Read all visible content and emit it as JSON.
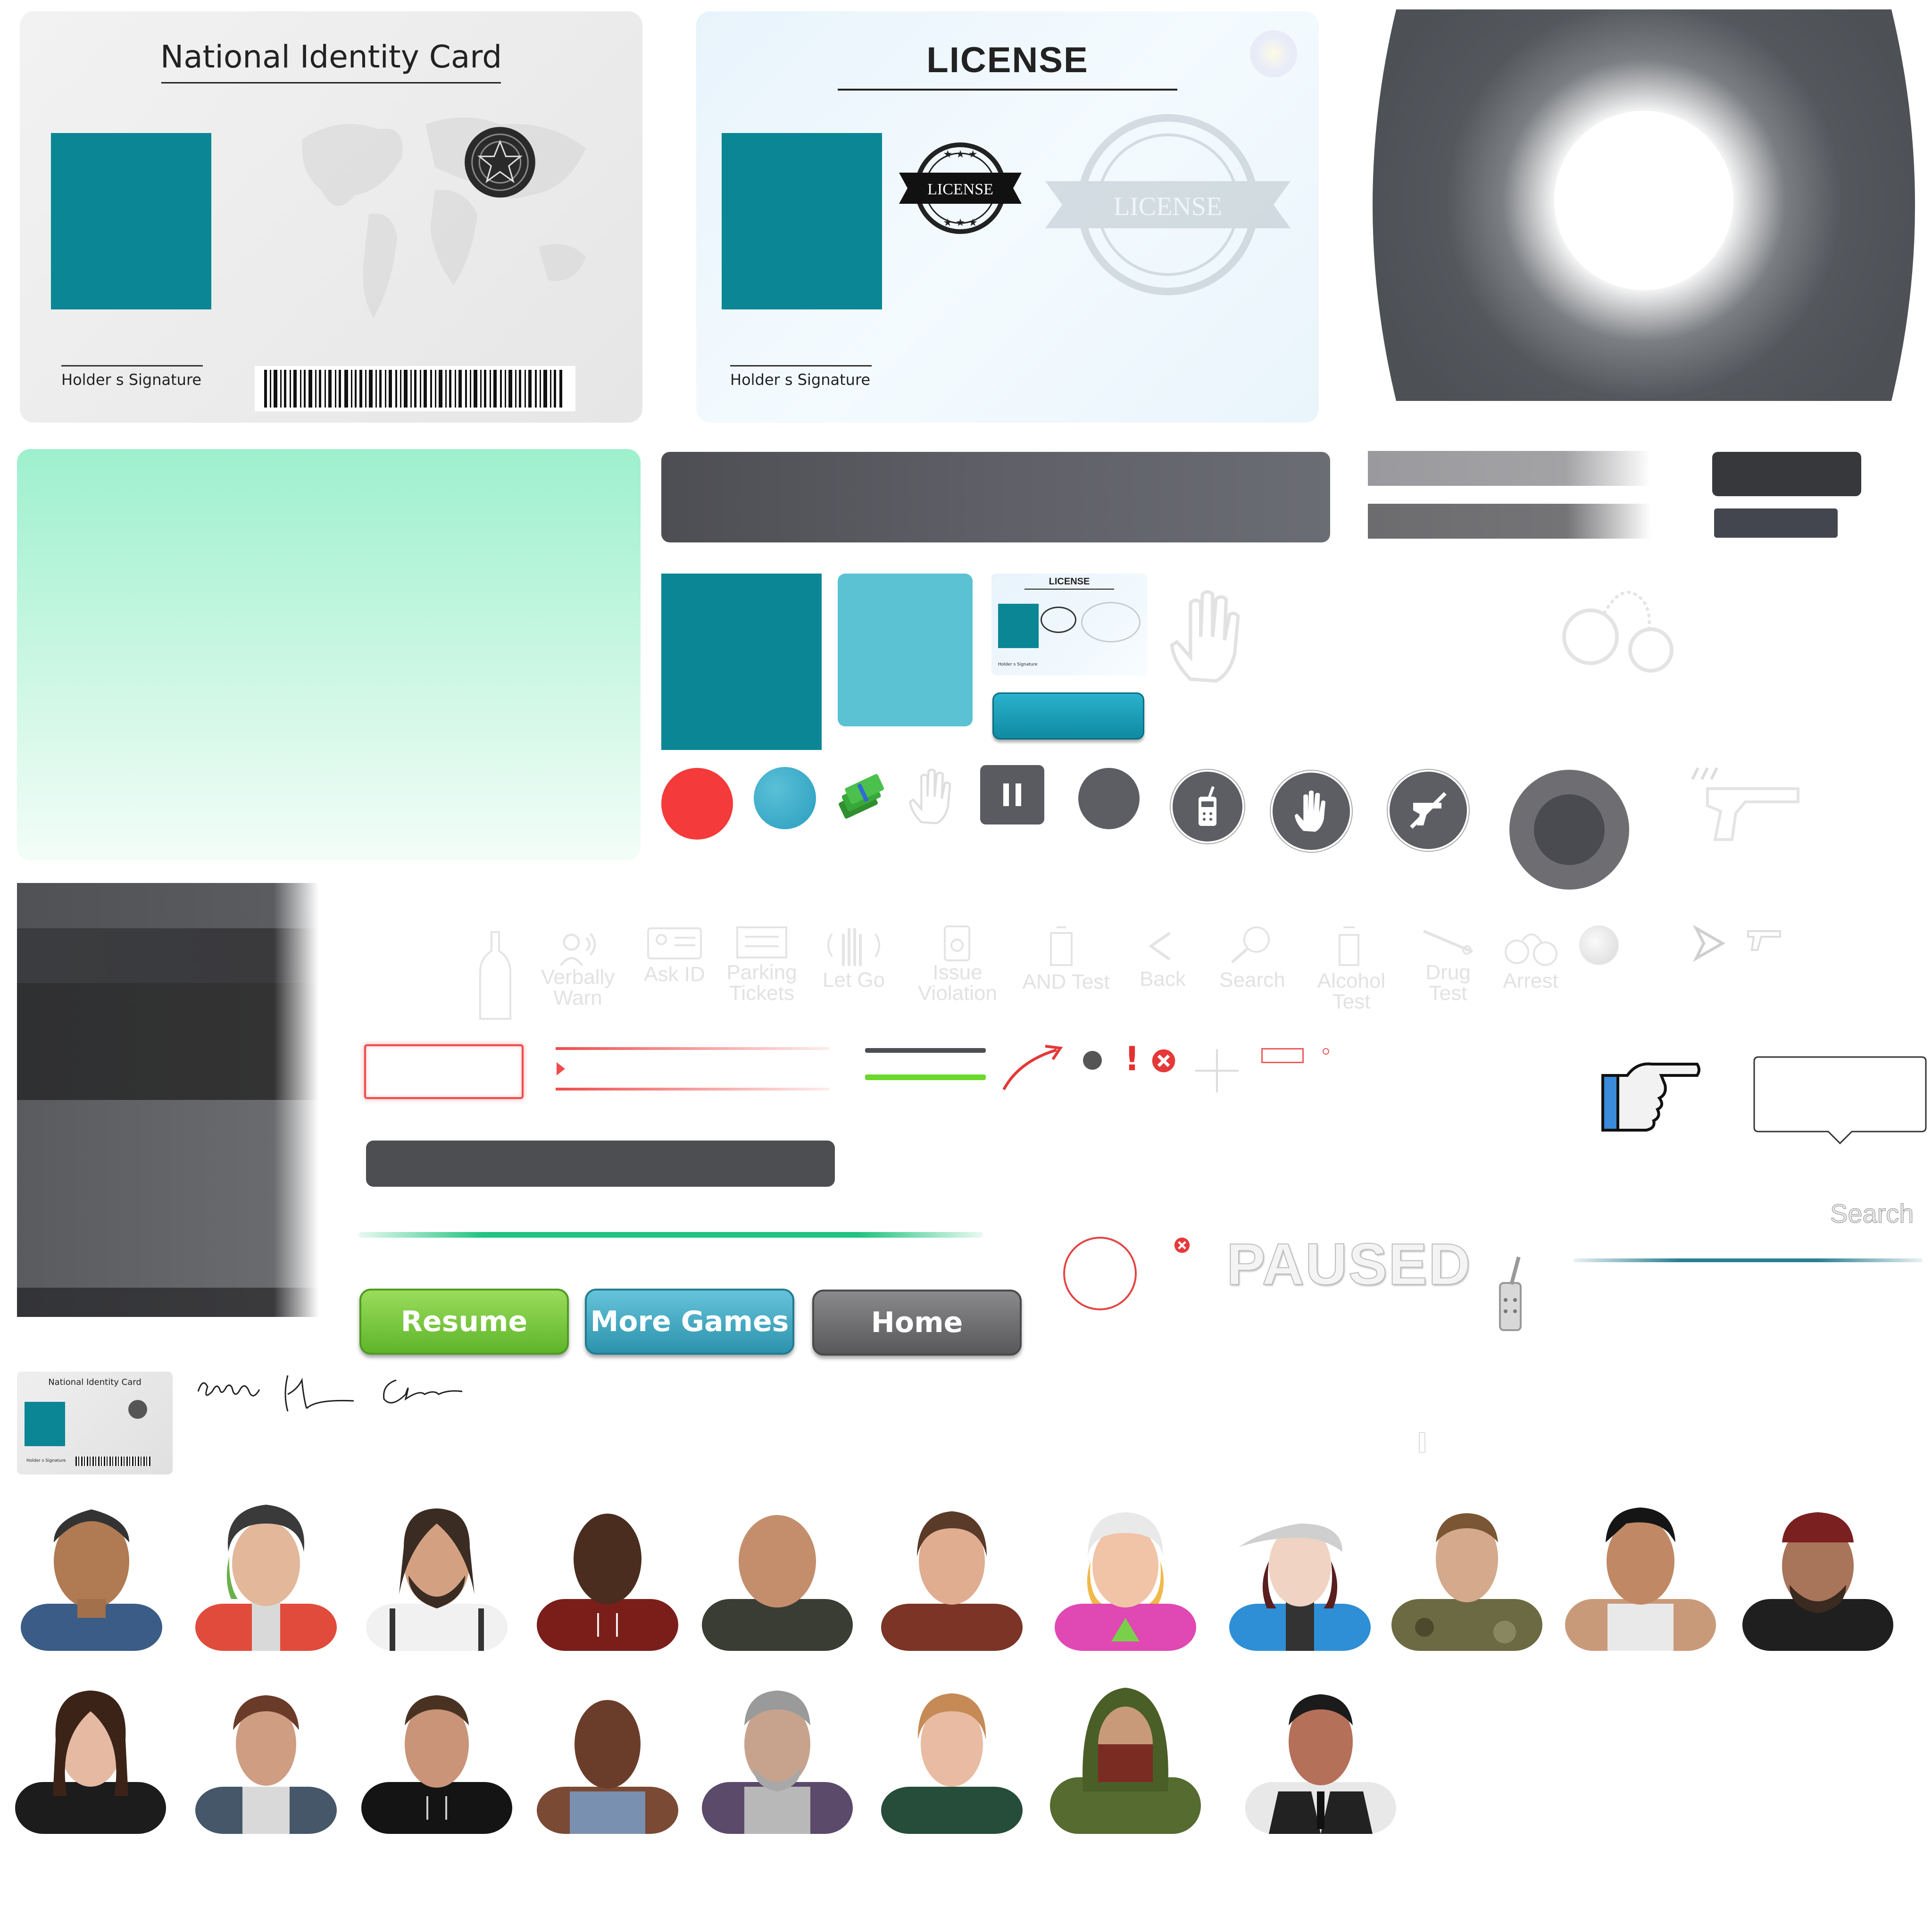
{
  "id_card": {
    "title": "National Identity Card",
    "signature_label": "Holder s Signature"
  },
  "license_card": {
    "title": "LICENSE",
    "stamp_text": "LICENSE",
    "watermark_text": "LICENSE",
    "signature_label": "Holder s Signature"
  },
  "mini_license": {
    "title": "LICENSE",
    "signature_label": "Holder s Signature"
  },
  "mini_id_card": {
    "title": "National Identity Card",
    "signature_label": "Holder s Signature"
  },
  "action_labels": [
    {
      "icon": "bottle-icon",
      "label": ""
    },
    {
      "icon": "speak-icon",
      "label": "Verbally Warn"
    },
    {
      "icon": "id-card-icon",
      "label": "Ask ID"
    },
    {
      "icon": "ticket-icon",
      "label": "Parking Tickets"
    },
    {
      "icon": "hand-icon",
      "label": "Let Go"
    },
    {
      "icon": "violation-icon",
      "label": "Issue Violation"
    },
    {
      "icon": "and-test-icon",
      "label": "AND Test"
    },
    {
      "icon": "back-icon",
      "label": "Back"
    },
    {
      "icon": "search-icon",
      "label": "Search"
    },
    {
      "icon": "alcohol-test-icon",
      "label": "Alcohol Test"
    },
    {
      "icon": "drug-test-icon",
      "label": "Drug Test"
    },
    {
      "icon": "handcuffs-icon",
      "label": "Arrest"
    }
  ],
  "buttons": {
    "resume": "Resume",
    "more_games": "More Games",
    "home": "Home"
  },
  "paused_text": "PAUSED",
  "search_label": "Search",
  "colors": {
    "teal": "#0b8695",
    "light_teal": "#5bc2d4",
    "mint": "#9ef0cd",
    "red": "#f43a3a",
    "dark_gray": "#5a5b61",
    "green_button": "#75c93c",
    "blue_button": "#3ea6c0",
    "gray_button": "#6d6d70"
  },
  "portraits_row1": [
    "portrait-young-man",
    "portrait-woman-beanie",
    "portrait-bearded-man",
    "portrait-man-red-hoodie",
    "portrait-bald-man",
    "portrait-woman-brown-top",
    "portrait-girl-white-cap",
    "portrait-woman-cap-blue-jacket",
    "portrait-man-camo-jacket",
    "portrait-man-tank-top",
    "portrait-man-bandana"
  ],
  "portraits_row2": [
    "portrait-woman-leather-jacket",
    "portrait-woman-short-hair",
    "portrait-man-black-hoodie",
    "portrait-woman-blue-tank",
    "portrait-old-man",
    "portrait-woman-green-top",
    "portrait-hooded-masked-man",
    "portrait-man-suit-vest"
  ]
}
